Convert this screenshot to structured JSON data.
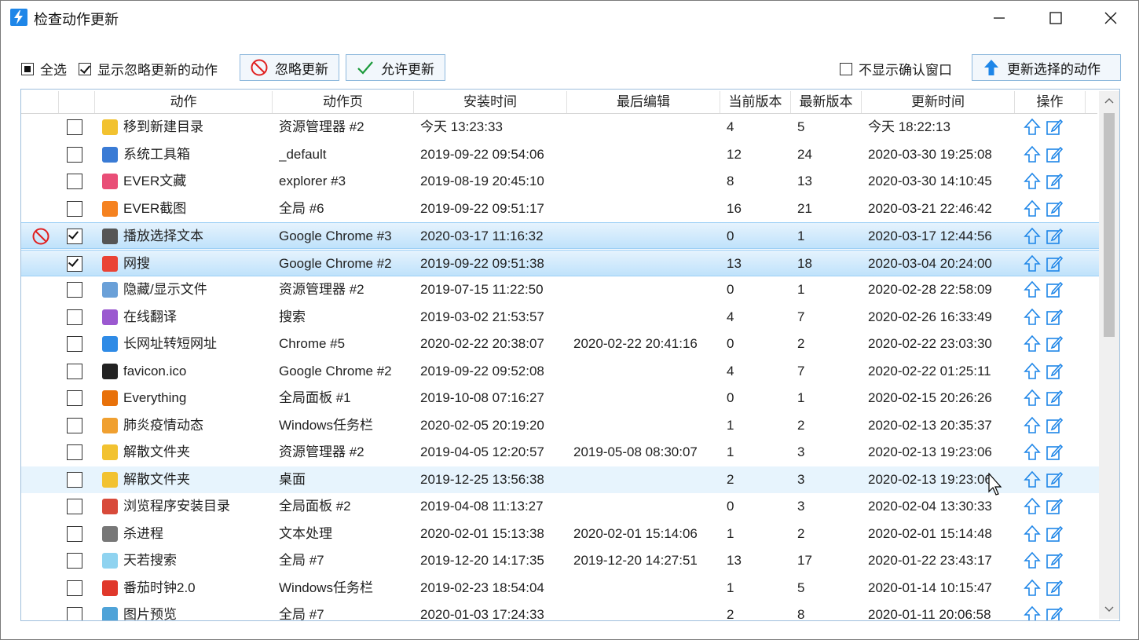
{
  "window": {
    "title": "检查动作更新"
  },
  "toolbar": {
    "select_all": "全选",
    "show_ignored": "显示忽略更新的动作",
    "ignore_btn": "忽略更新",
    "allow_btn": "允许更新",
    "no_confirm": "不显示确认窗口",
    "update_btn": "更新选择的动作"
  },
  "columns": [
    "动作",
    "动作页",
    "安装时间",
    "最后编辑",
    "当前版本",
    "最新版本",
    "更新时间",
    "操作"
  ],
  "rows": [
    {
      "name": "移到新建目录",
      "page": "资源管理器 #2",
      "installed": "今天 13:23:33",
      "edited": "",
      "current": "4",
      "latest": "5",
      "updated": "今天 18:22:13",
      "icon": "folder-arrow-icon",
      "color": "#f2c230",
      "checked": false,
      "ignored": false,
      "state": ""
    },
    {
      "name": "系统工具箱",
      "page": "_default",
      "installed": "2019-09-22 09:54:06",
      "edited": "",
      "current": "12",
      "latest": "24",
      "updated": "2020-03-30 19:25:08",
      "icon": "gear-icon",
      "color": "#3a7bd5",
      "checked": false,
      "ignored": false,
      "state": ""
    },
    {
      "name": "EVER文藏",
      "page": "explorer #3",
      "installed": "2019-08-19 20:45:10",
      "edited": "",
      "current": "8",
      "latest": "13",
      "updated": "2020-03-30 14:10:45",
      "icon": "bookmark-icon",
      "color": "#e94e77",
      "checked": false,
      "ignored": false,
      "state": ""
    },
    {
      "name": "EVER截图",
      "page": "全局 #6",
      "installed": "2019-09-22 09:51:17",
      "edited": "",
      "current": "16",
      "latest": "21",
      "updated": "2020-03-21 22:46:42",
      "icon": "flower-icon",
      "color": "#f58220",
      "checked": false,
      "ignored": false,
      "state": ""
    },
    {
      "name": "播放选择文本",
      "page": "Google Chrome #3",
      "installed": "2020-03-17 11:16:32",
      "edited": "",
      "current": "0",
      "latest": "1",
      "updated": "2020-03-17 12:44:56",
      "icon": "play-icon",
      "color": "#555555",
      "checked": true,
      "ignored": true,
      "state": "sel"
    },
    {
      "name": "网搜",
      "page": "Google Chrome #2",
      "installed": "2019-09-22 09:51:38",
      "edited": "",
      "current": "13",
      "latest": "18",
      "updated": "2020-03-04 20:24:00",
      "icon": "search-icon",
      "color": "#ea4335",
      "checked": true,
      "ignored": false,
      "state": "sel"
    },
    {
      "name": "隐藏/显示文件",
      "page": "资源管理器 #2",
      "installed": "2019-07-15 11:22:50",
      "edited": "",
      "current": "0",
      "latest": "1",
      "updated": "2020-02-28 22:58:09",
      "icon": "file-dotted-icon",
      "color": "#6aa0d8",
      "checked": false,
      "ignored": false,
      "state": ""
    },
    {
      "name": "在线翻译",
      "page": "搜索",
      "installed": "2019-03-02 21:53:57",
      "edited": "",
      "current": "4",
      "latest": "7",
      "updated": "2020-02-26 16:33:49",
      "icon": "translate-icon",
      "color": "#9b59d0",
      "checked": false,
      "ignored": false,
      "state": ""
    },
    {
      "name": "长网址转短网址",
      "page": "Chrome #5",
      "installed": "2020-02-22 20:38:07",
      "edited": "2020-02-22 20:41:16",
      "current": "0",
      "latest": "2",
      "updated": "2020-02-22 23:03:30",
      "icon": "link-icon",
      "color": "#2f8be6",
      "checked": false,
      "ignored": false,
      "state": ""
    },
    {
      "name": "favicon.ico",
      "page": "Google Chrome #2",
      "installed": "2019-09-22 09:52:08",
      "edited": "",
      "current": "4",
      "latest": "7",
      "updated": "2020-02-22 01:25:11",
      "icon": "globe-icon",
      "color": "#222222",
      "checked": false,
      "ignored": false,
      "state": ""
    },
    {
      "name": "Everything",
      "page": "全局面板 #1",
      "installed": "2019-10-08 07:16:27",
      "edited": "",
      "current": "0",
      "latest": "1",
      "updated": "2020-02-15 20:26:26",
      "icon": "magnifier-icon",
      "color": "#e8710a",
      "checked": false,
      "ignored": false,
      "state": ""
    },
    {
      "name": "肺炎疫情动态",
      "page": "Windows任务栏",
      "installed": "2020-02-05 20:19:20",
      "edited": "",
      "current": "1",
      "latest": "2",
      "updated": "2020-02-13 20:35:37",
      "icon": "virus-icon",
      "color": "#f0a030",
      "checked": false,
      "ignored": false,
      "state": ""
    },
    {
      "name": "解散文件夹",
      "page": "资源管理器 #2",
      "installed": "2019-04-05 12:20:57",
      "edited": "2019-05-08 08:30:07",
      "current": "1",
      "latest": "3",
      "updated": "2020-02-13 19:23:06",
      "icon": "folder-icon",
      "color": "#f2c230",
      "checked": false,
      "ignored": false,
      "state": ""
    },
    {
      "name": "解散文件夹",
      "page": "桌面",
      "installed": "2019-12-25 13:56:38",
      "edited": "",
      "current": "2",
      "latest": "3",
      "updated": "2020-02-13 19:23:06",
      "icon": "folder-icon",
      "color": "#f2c230",
      "checked": false,
      "ignored": false,
      "state": "hover"
    },
    {
      "name": "浏览程序安装目录",
      "page": "全局面板 #2",
      "installed": "2019-04-08 11:13:27",
      "edited": "",
      "current": "0",
      "latest": "3",
      "updated": "2020-02-04 13:30:33",
      "icon": "box-icon",
      "color": "#d84a3a",
      "checked": false,
      "ignored": false,
      "state": ""
    },
    {
      "name": "杀进程",
      "page": "文本处理",
      "installed": "2020-02-01 15:13:38",
      "edited": "2020-02-01 15:14:06",
      "current": "1",
      "latest": "2",
      "updated": "2020-02-01 15:14:48",
      "icon": "sad-face-icon",
      "color": "#777777",
      "checked": false,
      "ignored": false,
      "state": ""
    },
    {
      "name": "天若搜索",
      "page": "全局 #7",
      "installed": "2019-12-20 14:17:35",
      "edited": "2019-12-20 14:27:51",
      "current": "13",
      "latest": "17",
      "updated": "2020-01-22 23:43:17",
      "icon": "diamond-icon",
      "color": "#8fd3f0",
      "checked": false,
      "ignored": false,
      "state": ""
    },
    {
      "name": "番茄时钟2.0",
      "page": "Windows任务栏",
      "installed": "2019-02-23 18:54:04",
      "edited": "",
      "current": "1",
      "latest": "5",
      "updated": "2020-01-14 10:15:47",
      "icon": "tomato-icon",
      "color": "#e0382b",
      "checked": false,
      "ignored": false,
      "state": ""
    },
    {
      "name": "图片预览",
      "page": "全局 #7",
      "installed": "2020-01-03 17:24:33",
      "edited": "",
      "current": "2",
      "latest": "8",
      "updated": "2020-01-11 20:06:58",
      "icon": "image-icon",
      "color": "#4fa3d8",
      "checked": false,
      "ignored": false,
      "state": ""
    }
  ],
  "colors": {
    "accent": "#1e86e8",
    "selection": "#bfe2fb",
    "ignore_red": "#e02020",
    "allow_green": "#1a9a3a"
  }
}
